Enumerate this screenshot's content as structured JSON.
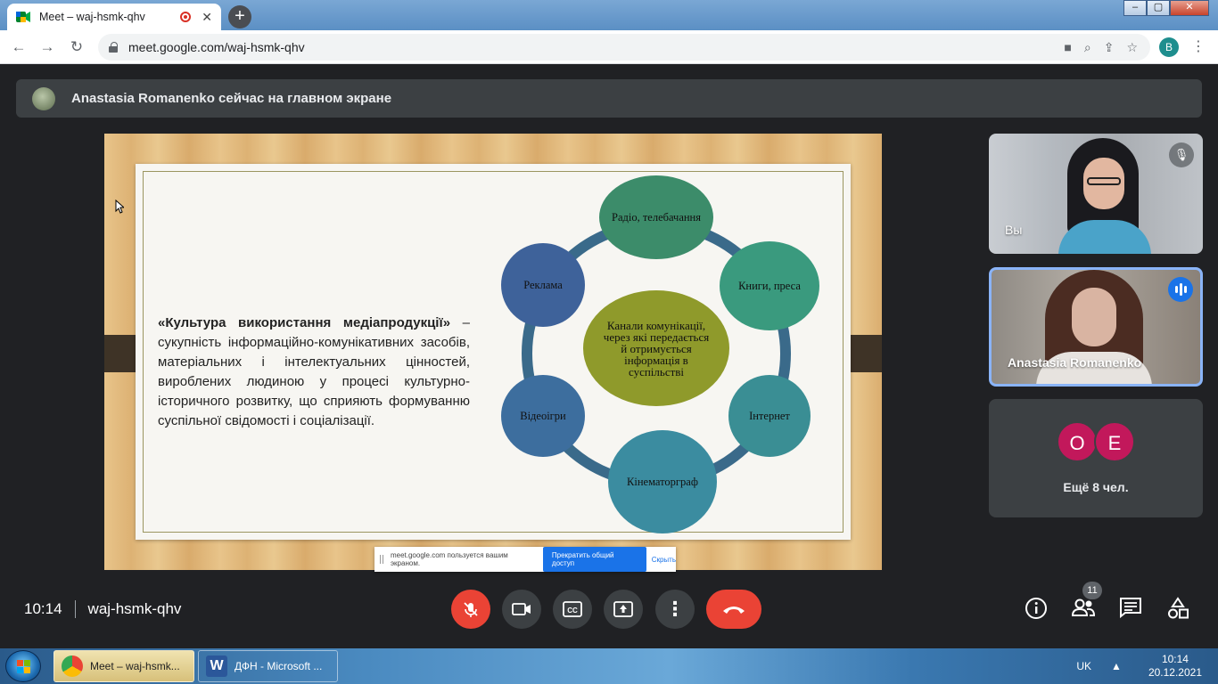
{
  "browser": {
    "tab_title": "Meet – waj-hsmk-qhv",
    "tab_close": "✕",
    "new_tab": "+",
    "url": "meet.google.com/waj-hsmk-qhv",
    "profile_initial": "B",
    "window_controls": [
      "–",
      "▢",
      "✕"
    ]
  },
  "banner": {
    "text": "Anastasia Romanenko сейчас на главном экране"
  },
  "slide": {
    "heading": "«Культура використання медіапродукції»",
    "body": " – сукупність інформаційно-комунікативних засобів, матеріальних і інтелектуальних цінностей, вироблених людиною у процесі культурно-історичного розвитку, що сприяють формуванню суспільної свідомості і соціалізації.",
    "diagram": {
      "center": "Канали комунікації, через які передається й отримується інформація в суспільстві",
      "nodes": [
        "Радіо, телебачання",
        "Книги, преса",
        "Інтернет",
        "Кінематорграф",
        "Відеоігри",
        "Реклама"
      ]
    },
    "share_bar": {
      "text": "meet.google.com пользуется вашим экраном.",
      "stop_label": "Прекратить общий доступ",
      "hide_label": "Скрыть"
    }
  },
  "participants": {
    "self_name": "Вы",
    "speaker_name": "Anastasia Romanenko",
    "more_initials": [
      "O",
      "E"
    ],
    "more_label": "Ещё 8 чел.",
    "avatar_colors": [
      "#c2185b",
      "#c2185b"
    ]
  },
  "controls": {
    "time": "10:14",
    "meeting_code": "waj-hsmk-qhv",
    "people_count": "11"
  },
  "taskbar": {
    "items": [
      "Meet – waj-hsmk...",
      "ДФН - Microsoft ..."
    ],
    "lang": "UK",
    "time": "10:14",
    "date": "20.12.2021"
  }
}
